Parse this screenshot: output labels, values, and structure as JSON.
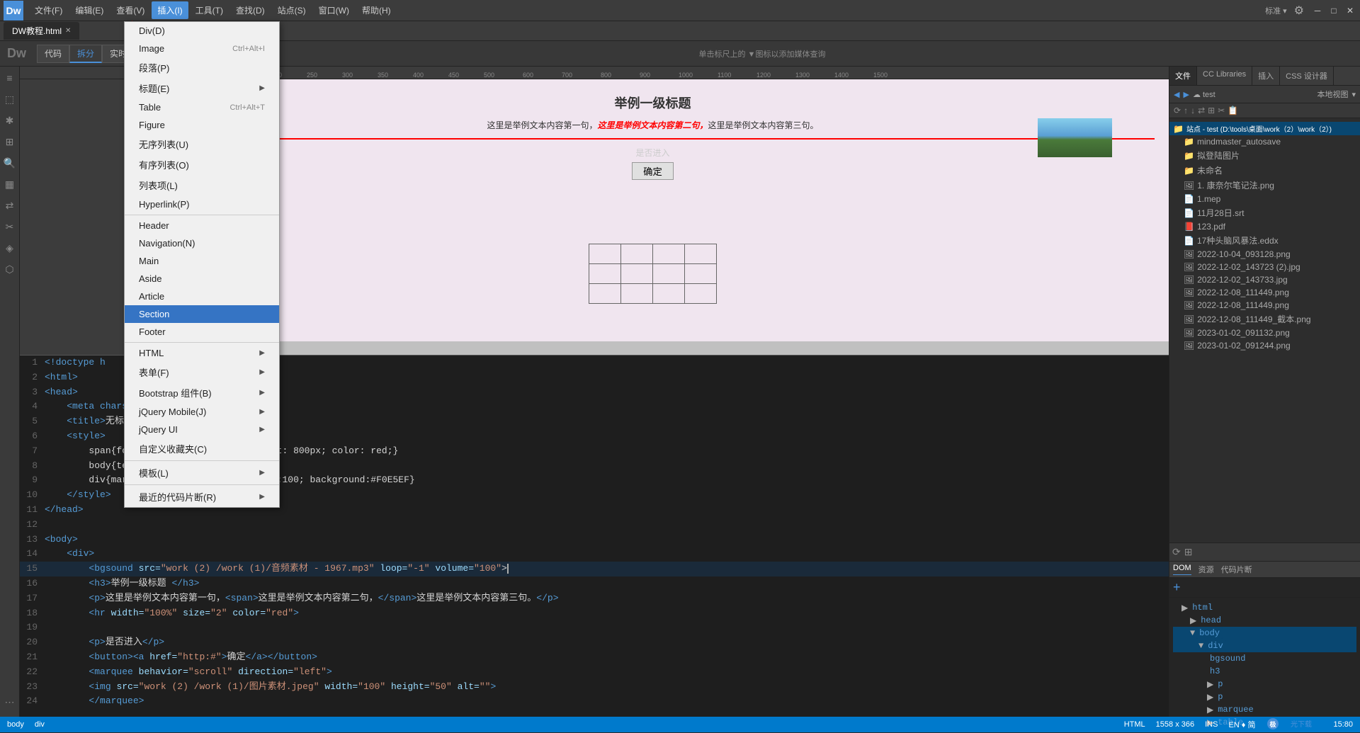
{
  "app": {
    "title": "Dw",
    "logo": "Dw"
  },
  "menubar": {
    "items": [
      {
        "label": "文件(F)",
        "id": "file"
      },
      {
        "label": "编辑(E)",
        "id": "edit"
      },
      {
        "label": "查看(V)",
        "id": "view"
      },
      {
        "label": "插入(I)",
        "id": "insert",
        "active": true
      },
      {
        "label": "工具(T)",
        "id": "tools"
      },
      {
        "label": "查找(D)",
        "id": "find"
      },
      {
        "label": "站点(S)",
        "id": "site"
      },
      {
        "label": "窗口(W)",
        "id": "window"
      },
      {
        "label": "帮助(H)",
        "id": "help"
      }
    ]
  },
  "insert_menu": {
    "items": [
      {
        "label": "Div(D)",
        "id": "div",
        "shortcut": "",
        "has_arrow": false
      },
      {
        "label": "Image",
        "id": "image",
        "shortcut": "Ctrl+Alt+I",
        "has_arrow": false
      },
      {
        "label": "段落(P)",
        "id": "paragraph",
        "shortcut": "",
        "has_arrow": false
      },
      {
        "label": "标题(E)",
        "id": "heading",
        "shortcut": "",
        "has_arrow": true
      },
      {
        "label": "Table",
        "id": "table",
        "shortcut": "Ctrl+Alt+T",
        "has_arrow": false
      },
      {
        "label": "Figure",
        "id": "figure",
        "shortcut": "",
        "has_arrow": false
      },
      {
        "label": "无序列表(U)",
        "id": "ul",
        "shortcut": "",
        "has_arrow": false
      },
      {
        "label": "有序列表(O)",
        "id": "ol",
        "shortcut": "",
        "has_arrow": false
      },
      {
        "label": "列表项(L)",
        "id": "li",
        "shortcut": "",
        "has_arrow": false
      },
      {
        "label": "Hyperlink(P)",
        "id": "hyperlink",
        "shortcut": "",
        "has_arrow": false
      },
      {
        "label": "divider1",
        "id": "div1"
      },
      {
        "label": "Header",
        "id": "header",
        "shortcut": "",
        "has_arrow": false
      },
      {
        "label": "Navigation(N)",
        "id": "nav",
        "shortcut": "",
        "has_arrow": false
      },
      {
        "label": "Main",
        "id": "main",
        "shortcut": "",
        "has_arrow": false
      },
      {
        "label": "Aside",
        "id": "aside",
        "shortcut": "",
        "has_arrow": false
      },
      {
        "label": "Article",
        "id": "article",
        "shortcut": "",
        "has_arrow": false
      },
      {
        "label": "Section",
        "id": "section",
        "shortcut": "",
        "has_arrow": false,
        "highlighted": true
      },
      {
        "label": "Footer",
        "id": "footer",
        "shortcut": "",
        "has_arrow": false
      },
      {
        "label": "divider2",
        "id": "div2"
      },
      {
        "label": "HTML",
        "id": "html",
        "shortcut": "",
        "has_arrow": true
      },
      {
        "label": "表单(F)",
        "id": "form",
        "shortcut": "",
        "has_arrow": true
      },
      {
        "label": "Bootstrap 组件(B)",
        "id": "bootstrap",
        "shortcut": "",
        "has_arrow": true
      },
      {
        "label": "jQuery Mobile(J)",
        "id": "jquerymobile",
        "shortcut": "",
        "has_arrow": true
      },
      {
        "label": "jQuery UI",
        "id": "jqueryui",
        "shortcut": "",
        "has_arrow": true
      },
      {
        "label": "自定义收藏夹(C)",
        "id": "favorites",
        "shortcut": "",
        "has_arrow": false
      },
      {
        "label": "divider3",
        "id": "div3"
      },
      {
        "label": "模板(L)",
        "id": "template",
        "shortcut": "",
        "has_arrow": true
      },
      {
        "label": "divider4",
        "id": "div4"
      },
      {
        "label": "最近的代码片断(R)",
        "id": "recent",
        "shortcut": "",
        "has_arrow": true
      }
    ]
  },
  "tabs": [
    {
      "label": "DW教程.html",
      "active": true
    }
  ],
  "toolbar": {
    "modes": [
      "代码",
      "拆分",
      "实时视图"
    ],
    "active_mode": "拆分",
    "hint": "单击标尺上的 ▼图标以添加媒体查询"
  },
  "design": {
    "div_label": "div",
    "h3": "举例一级标题",
    "para_before": "这里是举例文本内容第一句，",
    "para_red": "这里是举例文本内容第二句，",
    "para_after": "这里是举例文本内容第三句。",
    "dialog_text": "是否进入",
    "button_text": "确定",
    "bg_color": "#F0E5EF"
  },
  "code": {
    "lines": [
      {
        "num": 1,
        "content": "<!doctype h",
        "type": "tag"
      },
      {
        "num": 2,
        "content": "<html>",
        "type": "tag"
      },
      {
        "num": 3,
        "content": "<head>",
        "type": "tag"
      },
      {
        "num": 4,
        "content": "    <meta charse",
        "type": "tag"
      },
      {
        "num": 5,
        "content": "    <title>无标题文档</title>",
        "type": "mixed"
      },
      {
        "num": 6,
        "content": "    <style>",
        "type": "tag"
      },
      {
        "num": 7,
        "content": "        span{font-style: italic;font-weight: 800px; color: red;}",
        "type": "css"
      },
      {
        "num": 8,
        "content": "        body{text-align: center}",
        "type": "css"
      },
      {
        "num": 9,
        "content": "        div{margin: auto;width:auto;height:100; background:#F0E5EF}",
        "type": "css"
      },
      {
        "num": 10,
        "content": "    </style>",
        "type": "tag"
      },
      {
        "num": 11,
        "content": "</head>",
        "type": "tag"
      },
      {
        "num": 12,
        "content": "",
        "type": "blank"
      },
      {
        "num": 13,
        "content": "<body>",
        "type": "tag"
      },
      {
        "num": 14,
        "content": "    <div>",
        "type": "tag"
      },
      {
        "num": 15,
        "content": "        <bgsound src=\"work (2) /work (1)/音频素材 - 1967.mp3\" loop=\"-1\" volume=\"100\">",
        "type": "tag"
      },
      {
        "num": 16,
        "content": "        <h3>举例一级标题 </h3>",
        "type": "mixed"
      },
      {
        "num": 17,
        "content": "        <p>这里是举例文本内容第一句，<span>这里是举例文本内容第二句，</span>这里是举例文本内容第三句。</p>",
        "type": "mixed"
      },
      {
        "num": 18,
        "content": "        <hr width=\"100%\" size=\"2\" color=\"red\">",
        "type": "tag"
      },
      {
        "num": 19,
        "content": "",
        "type": "blank"
      },
      {
        "num": 20,
        "content": "        <p>是否进入</p>",
        "type": "mixed"
      },
      {
        "num": 21,
        "content": "        <button><a href=\"http:#\">确定</a></button>",
        "type": "mixed"
      },
      {
        "num": 22,
        "content": "        <marquee behavior=\"scroll\" direction=\"left\">",
        "type": "tag"
      },
      {
        "num": 23,
        "content": "        <img src=\"work (2) /work (1)/图片素材.jpeg\" width=\"100\" height=\"50\" alt=\"\">",
        "type": "tag"
      },
      {
        "num": 24,
        "content": "        </marquee>",
        "type": "tag"
      }
    ]
  },
  "right_panel": {
    "tabs": [
      "文件",
      "CC Libraries",
      "插入",
      "CSS 设计器"
    ],
    "active_tab": "文件",
    "toolbar_icons": [
      "◀",
      "▶",
      "⟳",
      "☁",
      "📁",
      "↑",
      "↓",
      "⚙",
      "✂",
      "📋"
    ],
    "site_label": "站点 - test",
    "local_view": "本地视图",
    "file_tree": {
      "root": "站点 - test (D:\\tools\\桌面\\work（2）\\work（2）)",
      "items": [
        {
          "label": "mindmaster_autosave",
          "type": "folder",
          "indent": 1
        },
        {
          "label": "拟登陆图片",
          "type": "folder",
          "indent": 1
        },
        {
          "label": "未命名",
          "type": "folder",
          "indent": 1
        },
        {
          "label": "1. 康奈尔笔记法.png",
          "type": "file-img",
          "indent": 1
        },
        {
          "label": "1.mep",
          "type": "file",
          "indent": 1
        },
        {
          "label": "11月28日.srt",
          "type": "file",
          "indent": 1
        },
        {
          "label": "123.pdf",
          "type": "file-pdf",
          "indent": 1
        },
        {
          "label": "17种头脑风暴法.eddx",
          "type": "file",
          "indent": 1
        },
        {
          "label": "2022-10-04_093128.png",
          "type": "file-img",
          "indent": 1
        },
        {
          "label": "2022-12-02_143723 (2).jpg",
          "type": "file-img",
          "indent": 1
        },
        {
          "label": "2022-12-02_143733.jpg",
          "type": "file-img",
          "indent": 1
        },
        {
          "label": "2022-12-08_111449.png",
          "type": "file-img",
          "indent": 1
        },
        {
          "label": "2022-12-08_111449.png",
          "type": "file-img",
          "indent": 1
        },
        {
          "label": "2022-12-08_111449_截本.png",
          "type": "file-img",
          "indent": 1
        },
        {
          "label": "2023-01-02_091132.png",
          "type": "file-img",
          "indent": 1
        },
        {
          "label": "2023-01-02_091244.png",
          "type": "file-img",
          "indent": 1
        }
      ]
    }
  },
  "dom_panel": {
    "tabs": [
      "DOM",
      "资源",
      "代码片断"
    ],
    "active_tab": "DOM",
    "tree": [
      {
        "label": "html",
        "indent": 0,
        "expanded": true
      },
      {
        "label": "head",
        "indent": 1,
        "expanded": false
      },
      {
        "label": "body",
        "indent": 1,
        "expanded": true,
        "selected": true
      },
      {
        "label": "div",
        "indent": 2,
        "expanded": true,
        "selected": true
      },
      {
        "label": "bgsound",
        "indent": 3,
        "leaf": true
      },
      {
        "label": "h3",
        "indent": 3,
        "leaf": true
      },
      {
        "label": "p",
        "indent": 3,
        "leaf": true
      },
      {
        "label": "p",
        "indent": 3,
        "leaf": true
      },
      {
        "label": "marquee",
        "indent": 3,
        "leaf": true
      },
      {
        "label": "table",
        "indent": 3,
        "leaf": true
      }
    ]
  },
  "status_bar": {
    "tag": "body",
    "child_tag": "div",
    "lang": "HTML",
    "dimensions": "1558 x 366",
    "zoom": "INS",
    "encoding": "简",
    "en_label": "EN ♦ 简",
    "time": "15:80"
  },
  "window_controls": {
    "minimize": "─",
    "maximize": "□",
    "close": "✕"
  }
}
